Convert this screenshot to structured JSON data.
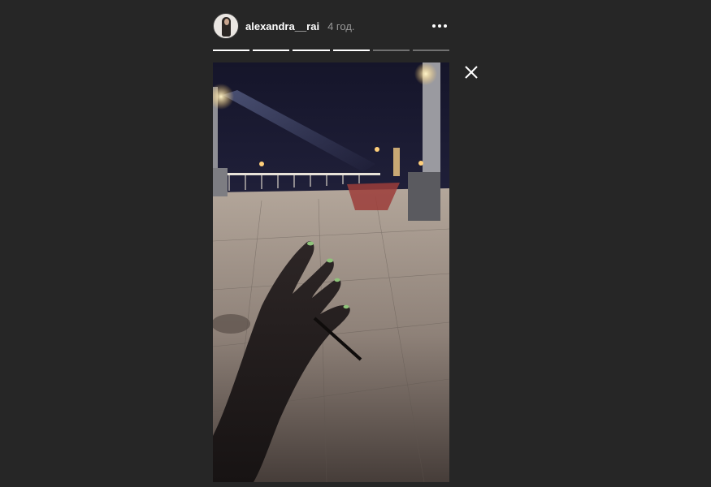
{
  "story": {
    "username": "alexandra__rai",
    "timestamp": "4 год.",
    "progress": [
      1,
      1,
      1,
      1,
      0,
      0
    ]
  },
  "icons": {
    "more": "more-horizontal-icon",
    "close": "close-icon"
  },
  "colors": {
    "background": "#262626",
    "text": "#ffffff",
    "muted": "#999999"
  }
}
